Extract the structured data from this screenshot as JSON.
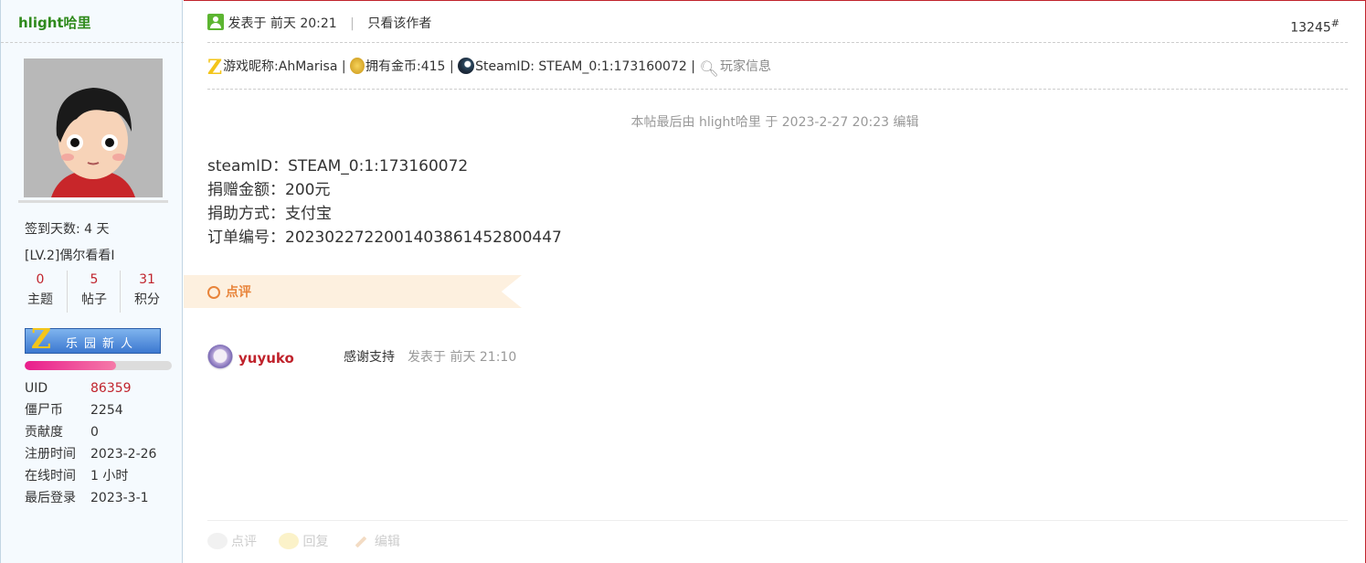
{
  "author": {
    "username": "hlight哈里",
    "sign_days": "签到天数: 4 天",
    "level": "[LV.2]偶尔看看I",
    "stats": [
      {
        "value": "0",
        "label": "主题"
      },
      {
        "value": "5",
        "label": "帖子"
      },
      {
        "value": "31",
        "label": "积分"
      }
    ],
    "medal": {
      "letter": "Z",
      "text": "乐园新人"
    },
    "progress": 0.62,
    "info": [
      {
        "key": "UID",
        "value": "86359"
      },
      {
        "key": "僵尸币",
        "value": "2254"
      },
      {
        "key": "贡献度",
        "value": "0"
      },
      {
        "key": "注册时间",
        "value": "2023-2-26"
      },
      {
        "key": "在线时间",
        "value": "1 小时"
      },
      {
        "key": "最后登录",
        "value": "2023-3-1"
      }
    ]
  },
  "post": {
    "posted_at": "发表于 前天 20:21",
    "separator": "|",
    "only_author": "只看该作者",
    "floor_number": "13245",
    "floor_suffix": "#",
    "game_nick": "游戏昵称:AhMarisa",
    "pipe": "|",
    "coins": "拥有金币:415",
    "steam_id_line": "SteamID: STEAM_0:1:173160072",
    "player_info": "玩家信息",
    "edited_note": "本帖最后由 hlight哈里 于 2023-2-27 20:23 编辑",
    "body": [
      {
        "label": "steamID：",
        "value": "STEAM_0:1:173160072"
      },
      {
        "label": "捐赠金额：",
        "value": "200元"
      },
      {
        "label": "捐助方式：",
        "value": "支付宝"
      },
      {
        "label": "订单编号：",
        "value": "2023022722001403861452800447"
      }
    ]
  },
  "review": {
    "tab_label": "点评",
    "comments": [
      {
        "user": "yuyuko",
        "text": "感谢支持",
        "time": "发表于 前天 21:10"
      }
    ]
  },
  "actions": {
    "review": "点评",
    "reply": "回复",
    "edit": "编辑"
  },
  "colors": {
    "accent_red": "#c0232c",
    "username_green": "#2f8a1c",
    "review_orange": "#e8843a"
  }
}
